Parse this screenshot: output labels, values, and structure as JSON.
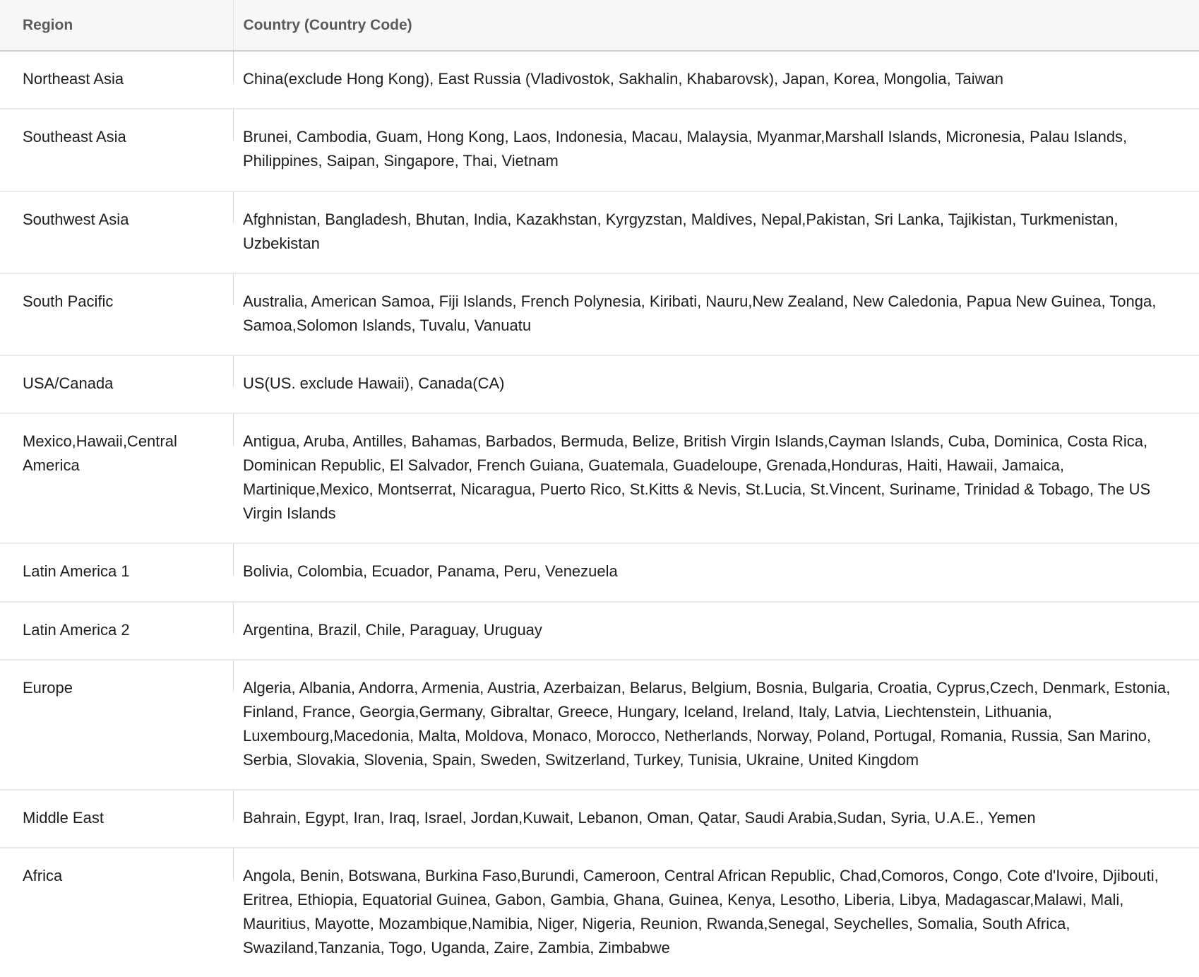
{
  "table": {
    "columns": [
      {
        "key": "region",
        "label": "Region"
      },
      {
        "key": "country",
        "label": "Country (Country Code)"
      }
    ],
    "rows": [
      {
        "region": "Northeast Asia",
        "country": "China(exclude Hong Kong), East Russia (Vladivostok, Sakhalin, Khabarovsk), Japan, Korea, Mongolia, Taiwan"
      },
      {
        "region": "Southeast Asia",
        "country": "Brunei, Cambodia, Guam, Hong Kong, Laos, Indonesia, Macau, Malaysia, Myanmar,Marshall Islands, Micronesia, Palau Islands, Philippines, Saipan, Singapore, Thai, Vietnam"
      },
      {
        "region": "Southwest Asia",
        "country": "Afghnistan, Bangladesh, Bhutan, India, Kazakhstan, Kyrgyzstan, Maldives, Nepal,Pakistan, Sri Lanka, Tajikistan, Turkmenistan, Uzbekistan"
      },
      {
        "region": "South Pacific",
        "country": "Australia, American Samoa, Fiji Islands, French Polynesia, Kiribati, Nauru,New Zealand, New Caledonia, Papua New Guinea, Tonga, Samoa,Solomon Islands, Tuvalu, Vanuatu"
      },
      {
        "region": "USA/Canada",
        "country": "US(US. exclude Hawaii), Canada(CA)"
      },
      {
        "region": "Mexico,Hawaii,Central America",
        "country": "Antigua, Aruba, Antilles, Bahamas, Barbados, Bermuda, Belize, British Virgin Islands,Cayman Islands, Cuba, Dominica, Costa Rica, Dominican Republic, El Salvador, French Guiana, Guatemala, Guadeloupe, Grenada,Honduras, Haiti, Hawaii, Jamaica, Martinique,Mexico, Montserrat, Nicaragua, Puerto Rico, St.Kitts & Nevis, St.Lucia, St.Vincent, Suriname, Trinidad & Tobago, The US Virgin Islands"
      },
      {
        "region": "Latin America 1",
        "country": "Bolivia, Colombia, Ecuador, Panama, Peru, Venezuela"
      },
      {
        "region": "Latin America 2",
        "country": "Argentina, Brazil, Chile, Paraguay, Uruguay"
      },
      {
        "region": "Europe",
        "country": "Algeria, Albania, Andorra, Armenia, Austria, Azerbaizan, Belarus, Belgium, Bosnia, Bulgaria, Croatia, Cyprus,Czech, Denmark, Estonia, Finland, France, Georgia,Germany, Gibraltar, Greece, Hungary, Iceland, Ireland, Italy, Latvia, Liechtenstein, Lithuania, Luxembourg,Macedonia, Malta, Moldova, Monaco, Morocco, Netherlands, Norway, Poland, Portugal, Romania, Russia, San Marino, Serbia, Slovakia, Slovenia, Spain, Sweden, Switzerland, Turkey, Tunisia, Ukraine, United Kingdom"
      },
      {
        "region": "Middle East",
        "country": "Bahrain, Egypt, Iran, Iraq, Israel, Jordan,Kuwait, Lebanon, Oman, Qatar, Saudi Arabia,Sudan, Syria, U.A.E., Yemen"
      },
      {
        "region": "Africa",
        "country": "Angola, Benin, Botswana, Burkina Faso,Burundi, Cameroon, Central African Republic, Chad,Comoros, Congo, Cote d'Ivoire, Djibouti, Eritrea, Ethiopia, Equatorial Guinea, Gabon, Gambia, Ghana, Guinea, Kenya, Lesotho, Liberia, Libya, Madagascar,Malawi, Mali, Mauritius, Mayotte, Mozambique,Namibia, Niger, Nigeria, Reunion, Rwanda,Senegal, Seychelles, Somalia, South Africa, Swaziland,Tanzania, Togo, Uganda, Zaire, Zambia, Zimbabwe"
      }
    ]
  },
  "colors": {
    "header_background": "#f7f7f7",
    "header_text": "#5a5a5a",
    "body_text": "#1d1d1d",
    "row_divider": "#e9e9e9",
    "header_divider": "#cfcfcf",
    "column_divider": "#d8d8d8",
    "page_background": "#ffffff"
  }
}
